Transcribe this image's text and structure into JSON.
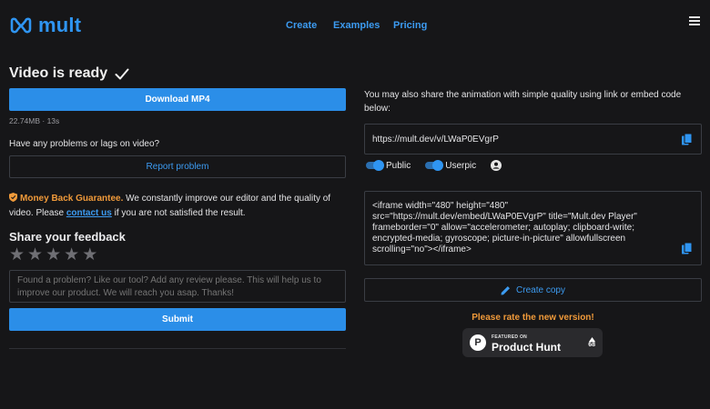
{
  "header": {
    "brand": "mult",
    "nav": [
      "Create",
      "Examples",
      "Pricing"
    ],
    "menu_icon": "hamburger-icon",
    "accent": "#2f95f2"
  },
  "video": {
    "title": "Video is ready",
    "download_label": "Download MP4",
    "meta": "22.74MB · 13s"
  },
  "problems": {
    "question": "Have any problems or lags on video?",
    "report_label": "Report problem"
  },
  "guarantee": {
    "badge": "Money Back Guarantee.",
    "text1": " We constantly improve our editor and the quality of video. Please ",
    "link": "contact us",
    "text2": " if you are not satisfied the result."
  },
  "feedback": {
    "title": "Share your feedback",
    "stars": 5,
    "placeholder": "Found a problem? Like our tool? Add any review please. This will help us to improve our product. We will reach you asap. Thanks!",
    "submit_label": "Submit"
  },
  "share": {
    "text": "You may also share the animation with simple quality using link or embed code below:",
    "link": "https://mult.dev/v/LWaP0EVgrP",
    "public_label": "Public",
    "userpic_label": "Userpic",
    "embed_code": "<iframe width=\"480\" height=\"480\" src=\"https://mult.dev/embed/LWaP0EVgrP\" title=\"Mult.dev Player\" frameborder=\"0\" allow=\"accelerometer; autoplay; clipboard-write; encrypted-media; gyroscope; picture-in-picture\" allowfullscreen scrolling=\"no\"></iframe>",
    "create_copy_label": "Create copy",
    "rate_text": "Please rate the new version!"
  },
  "product_hunt": {
    "featured": "FEATURED ON",
    "name": "Product Hunt",
    "votes": "68"
  }
}
